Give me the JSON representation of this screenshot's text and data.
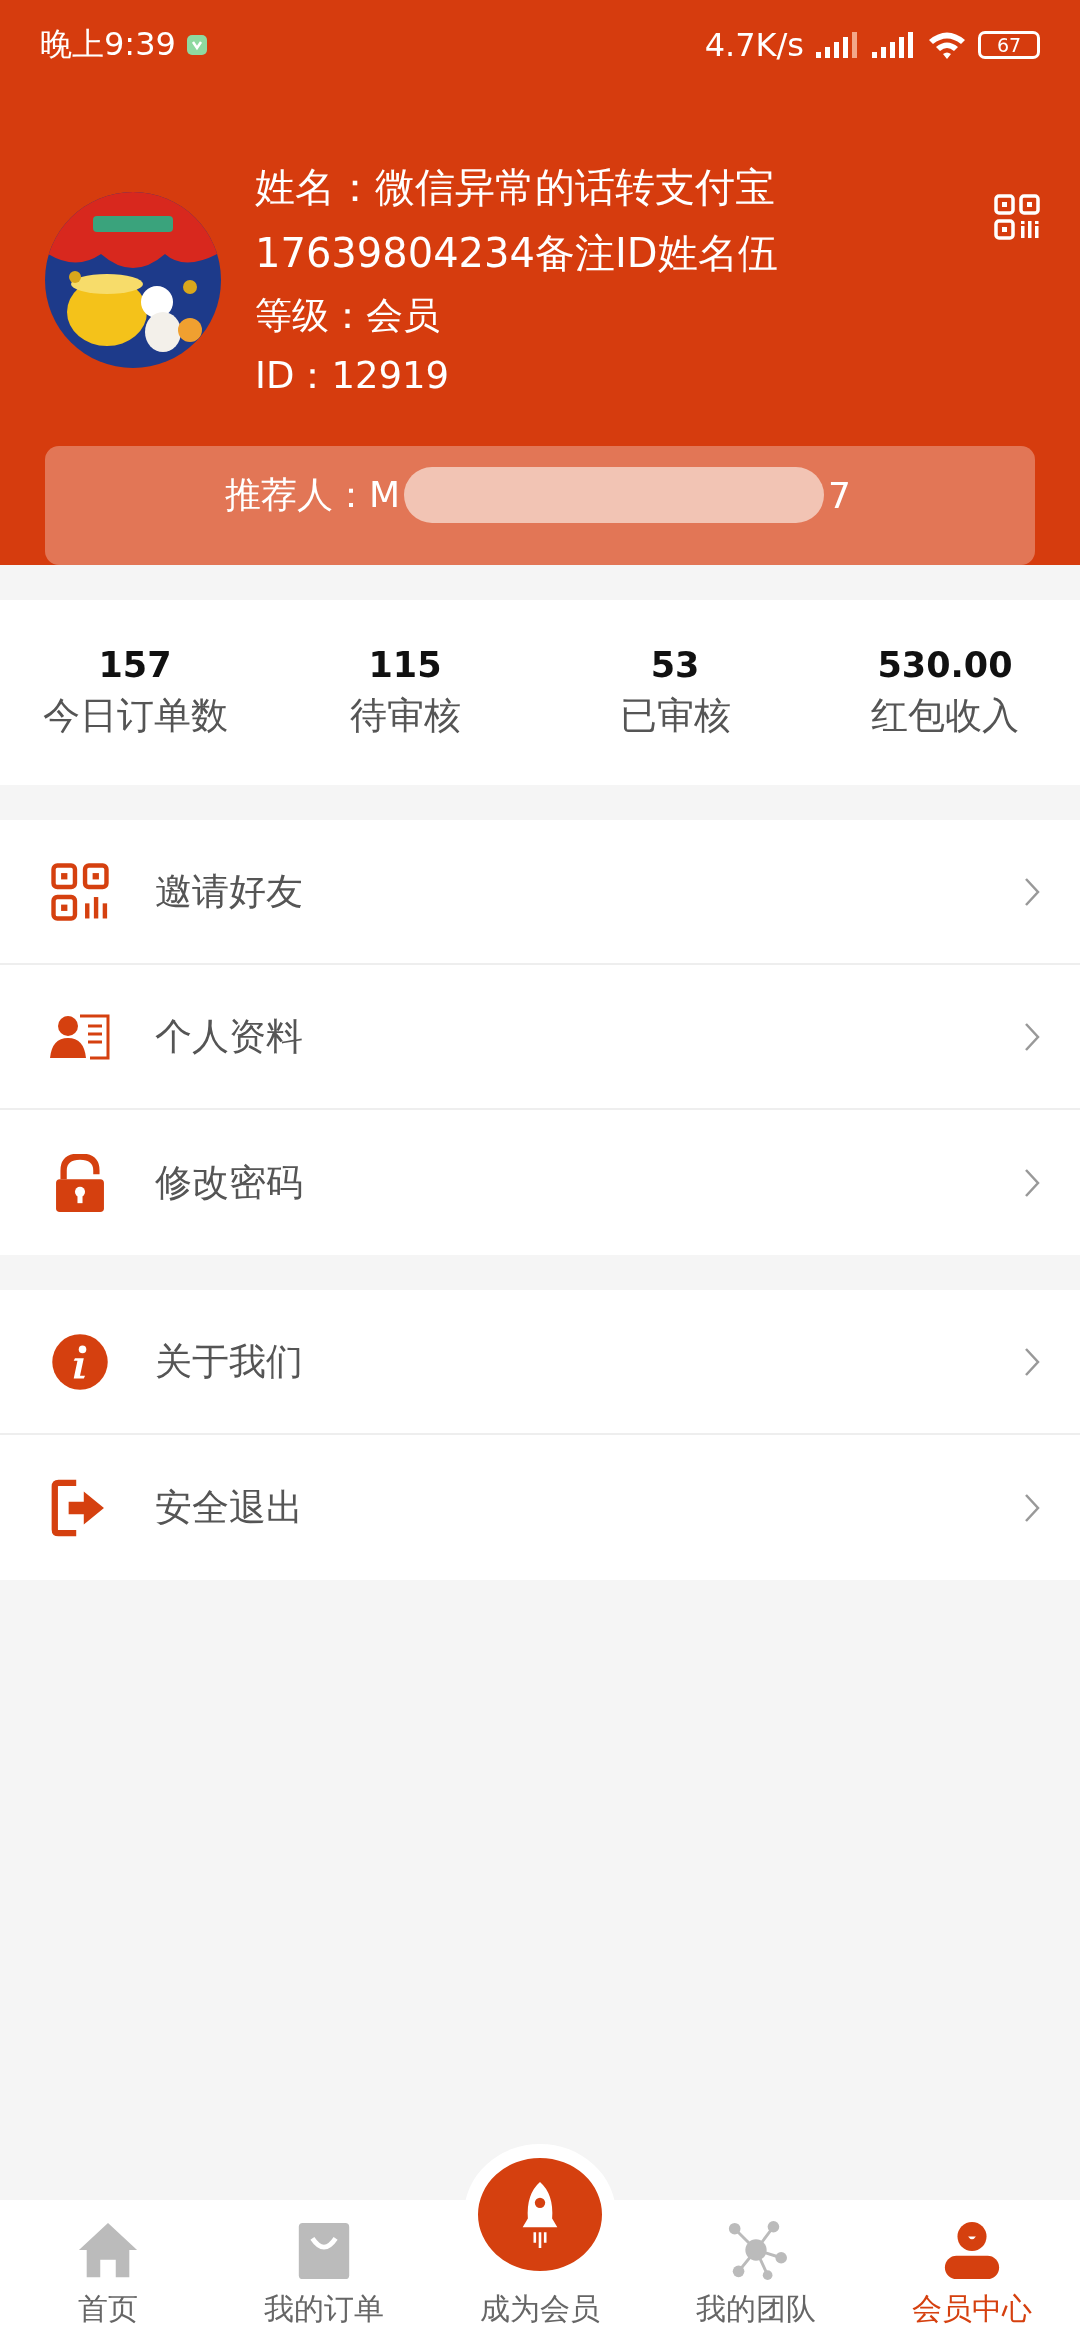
{
  "status_bar": {
    "time": "晚上9:39",
    "speed": "4.7K/s",
    "battery": "67"
  },
  "profile": {
    "name": "姓名：微信异常的话转支付宝17639804234备注ID姓名伍",
    "level": "等级：会员",
    "id": "ID：12919",
    "referrer_label": "推荐人：M",
    "referrer_tail": "7"
  },
  "stats": [
    {
      "value": "157",
      "label": "今日订单数"
    },
    {
      "value": "115",
      "label": "待审核"
    },
    {
      "value": "53",
      "label": "已审核"
    },
    {
      "value": "530.00",
      "label": "红包收入"
    }
  ],
  "menu_groups": [
    [
      {
        "label": "邀请好友"
      },
      {
        "label": "个人资料"
      },
      {
        "label": "修改密码"
      }
    ],
    [
      {
        "label": "关于我们"
      },
      {
        "label": "安全退出"
      }
    ]
  ],
  "tab_bar": [
    {
      "label": "首页",
      "selected": false
    },
    {
      "label": "我的订单",
      "selected": false
    },
    {
      "label": "成为会员",
      "selected": false
    },
    {
      "label": "我的团队",
      "selected": false
    },
    {
      "label": "会员中心",
      "selected": true
    }
  ]
}
